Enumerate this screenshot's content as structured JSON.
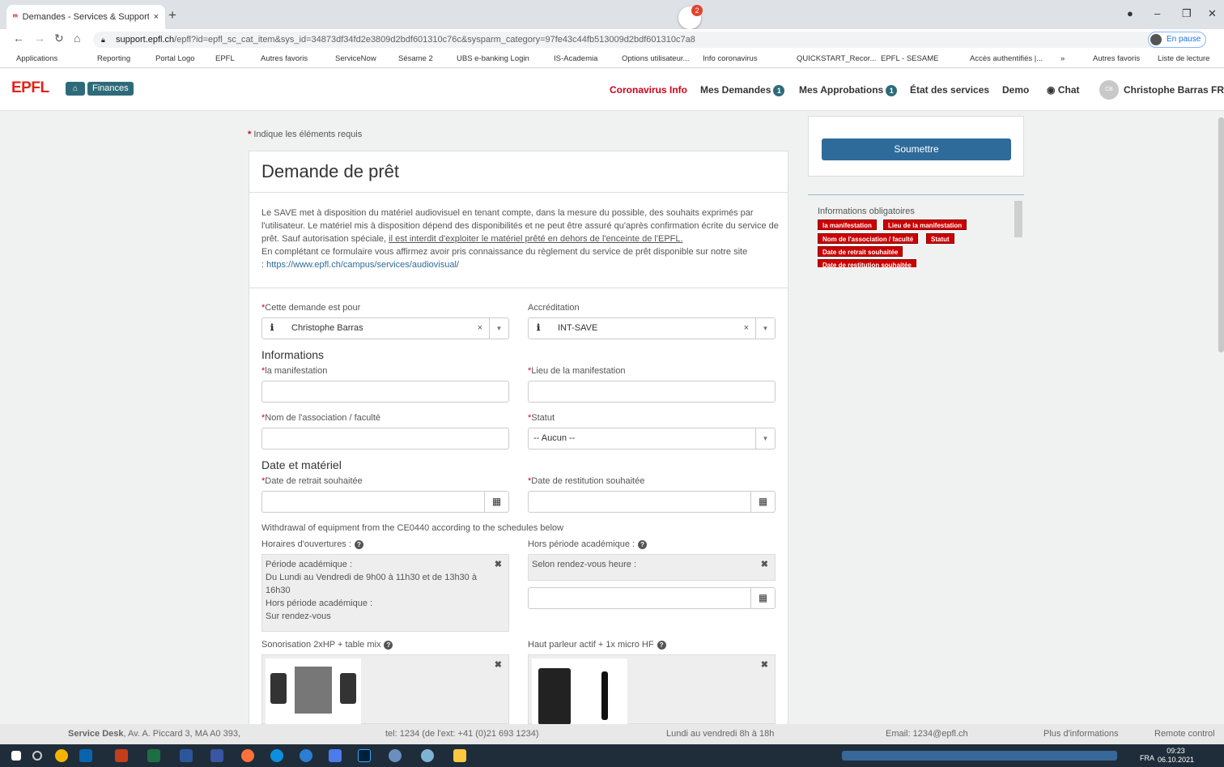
{
  "browser": {
    "tab_title": "Demandes - Services & Support",
    "tab_close": "×",
    "new_tab": "+",
    "url_host": "support.epfl.ch",
    "url_path": "/epfl?id=epfl_sc_cat_item&sys_id=34873df34fd2e3809d2bdf601310c76c&sysparm_category=97fe43c44fb513009d2bdf601310c7a8",
    "pause_label": "En pause",
    "chat_badge": "2",
    "bookmarks": [
      "Applications",
      "Reporting",
      "Portal Logo",
      "EPFL",
      "Autres favoris",
      "ServiceNow",
      "Sésame 2",
      "UBS e-banking Login",
      "IS-Academia",
      "Options utilisateur...",
      "Info coronavirus",
      "QUICKSTART_Recor...",
      "EPFL - SESAME",
      "Accès authentifiés |...",
      "»",
      "Autres favoris",
      "Liste de lecture"
    ]
  },
  "header": {
    "logo": "EPFL",
    "finances": "Finances",
    "nav": {
      "corona": "Coronavirus Info",
      "demandes": "Mes Demandes",
      "demandes_count": "1",
      "approbations": "Mes Approbations",
      "approbations_count": "1",
      "etat": "État des services",
      "demo": "Demo",
      "chat": "Chat",
      "avatar_initials": "CB",
      "user": "Christophe Barras",
      "lang": "FR"
    }
  },
  "form": {
    "required_note": "Indique les éléments requis",
    "title": "Demande de prêt",
    "intro_1": "Le SAVE met à disposition du matériel audiovisuel en tenant compte, dans la mesure du possible, des souhaits exprimés par l'utilisateur. Le matériel mis à disposition dépend des disponibilités et ne peut être assuré qu'après confirmation écrite du service de prêt. Sauf autorisation spéciale, ",
    "intro_u": "il est interdit d'exploiter le matériel prêté en dehors de l'enceinte de l'EPFL.",
    "intro_2": "En complétant ce formulaire vous affirmez avoir pris connaissance du règlement du service de prêt disponible sur notre site",
    "intro_link_prefix": ": ",
    "intro_link": "https://www.epfl.ch/campus/services/audiovisual/",
    "demande_pour_label": "Cette demande est pour",
    "demande_pour_value": "Christophe Barras",
    "accreditation_label": "Accréditation",
    "accreditation_value": "INT-SAVE",
    "section_info": "Informations",
    "manifestation_label": "la manifestation",
    "lieu_label": "Lieu de la manifestation",
    "association_label": "Nom de l'association / faculté",
    "statut_label": "Statut",
    "statut_value": "-- Aucun --",
    "section_date": "Date et matériel",
    "date_retrait_label": "Date de retrait souhaitée",
    "date_restitution_label": "Date de restitution souhaitée",
    "withdrawal_note": "Withdrawal of equipment from the CE0440 according to the schedules below",
    "horaires_label": "Horaires d'ouvertures :",
    "horaires_text": "Période académique :\nDu Lundi au Vendredi de 9h00 à 11h30 et de 13h30 à 16h30\nHors période académique :\nSur rendez-vous",
    "hors_label": "Hors période académique :",
    "hors_text": "Selon rendez-vous heure :",
    "sono_label": "Sonorisation 2xHP + table mix",
    "hp_label": "Haut parleur actif + 1x micro HF"
  },
  "sidebar": {
    "submit": "Soumettre",
    "mandatory_title": "Informations obligatoires",
    "tags": [
      "la manifestation",
      "Lieu de la manifestation",
      "Nom de l'association / faculté",
      "Statut",
      "Date de retrait souhaitée",
      "Date de restitution souhaitée"
    ]
  },
  "footer": {
    "desk_bold": "Service Desk",
    "desk_addr": ", Av. A. Piccard 3, MA A0 393,",
    "tel": "tel: 1234 (de l'ext: +41 (0)21 693 1234)",
    "hours": "Lundi au vendredi 8h à 18h",
    "email": "Email: 1234@epfl.ch",
    "more": "Plus d'informations",
    "remote": "Remote control"
  },
  "taskbar": {
    "time": "09:23",
    "date": "06.10.2021",
    "lang": "FRA"
  },
  "colors": {
    "accent": "#2e6b7a",
    "brand_red": "#e2231a",
    "required_red": "#d0021b",
    "submit": "#2e6b9a"
  }
}
